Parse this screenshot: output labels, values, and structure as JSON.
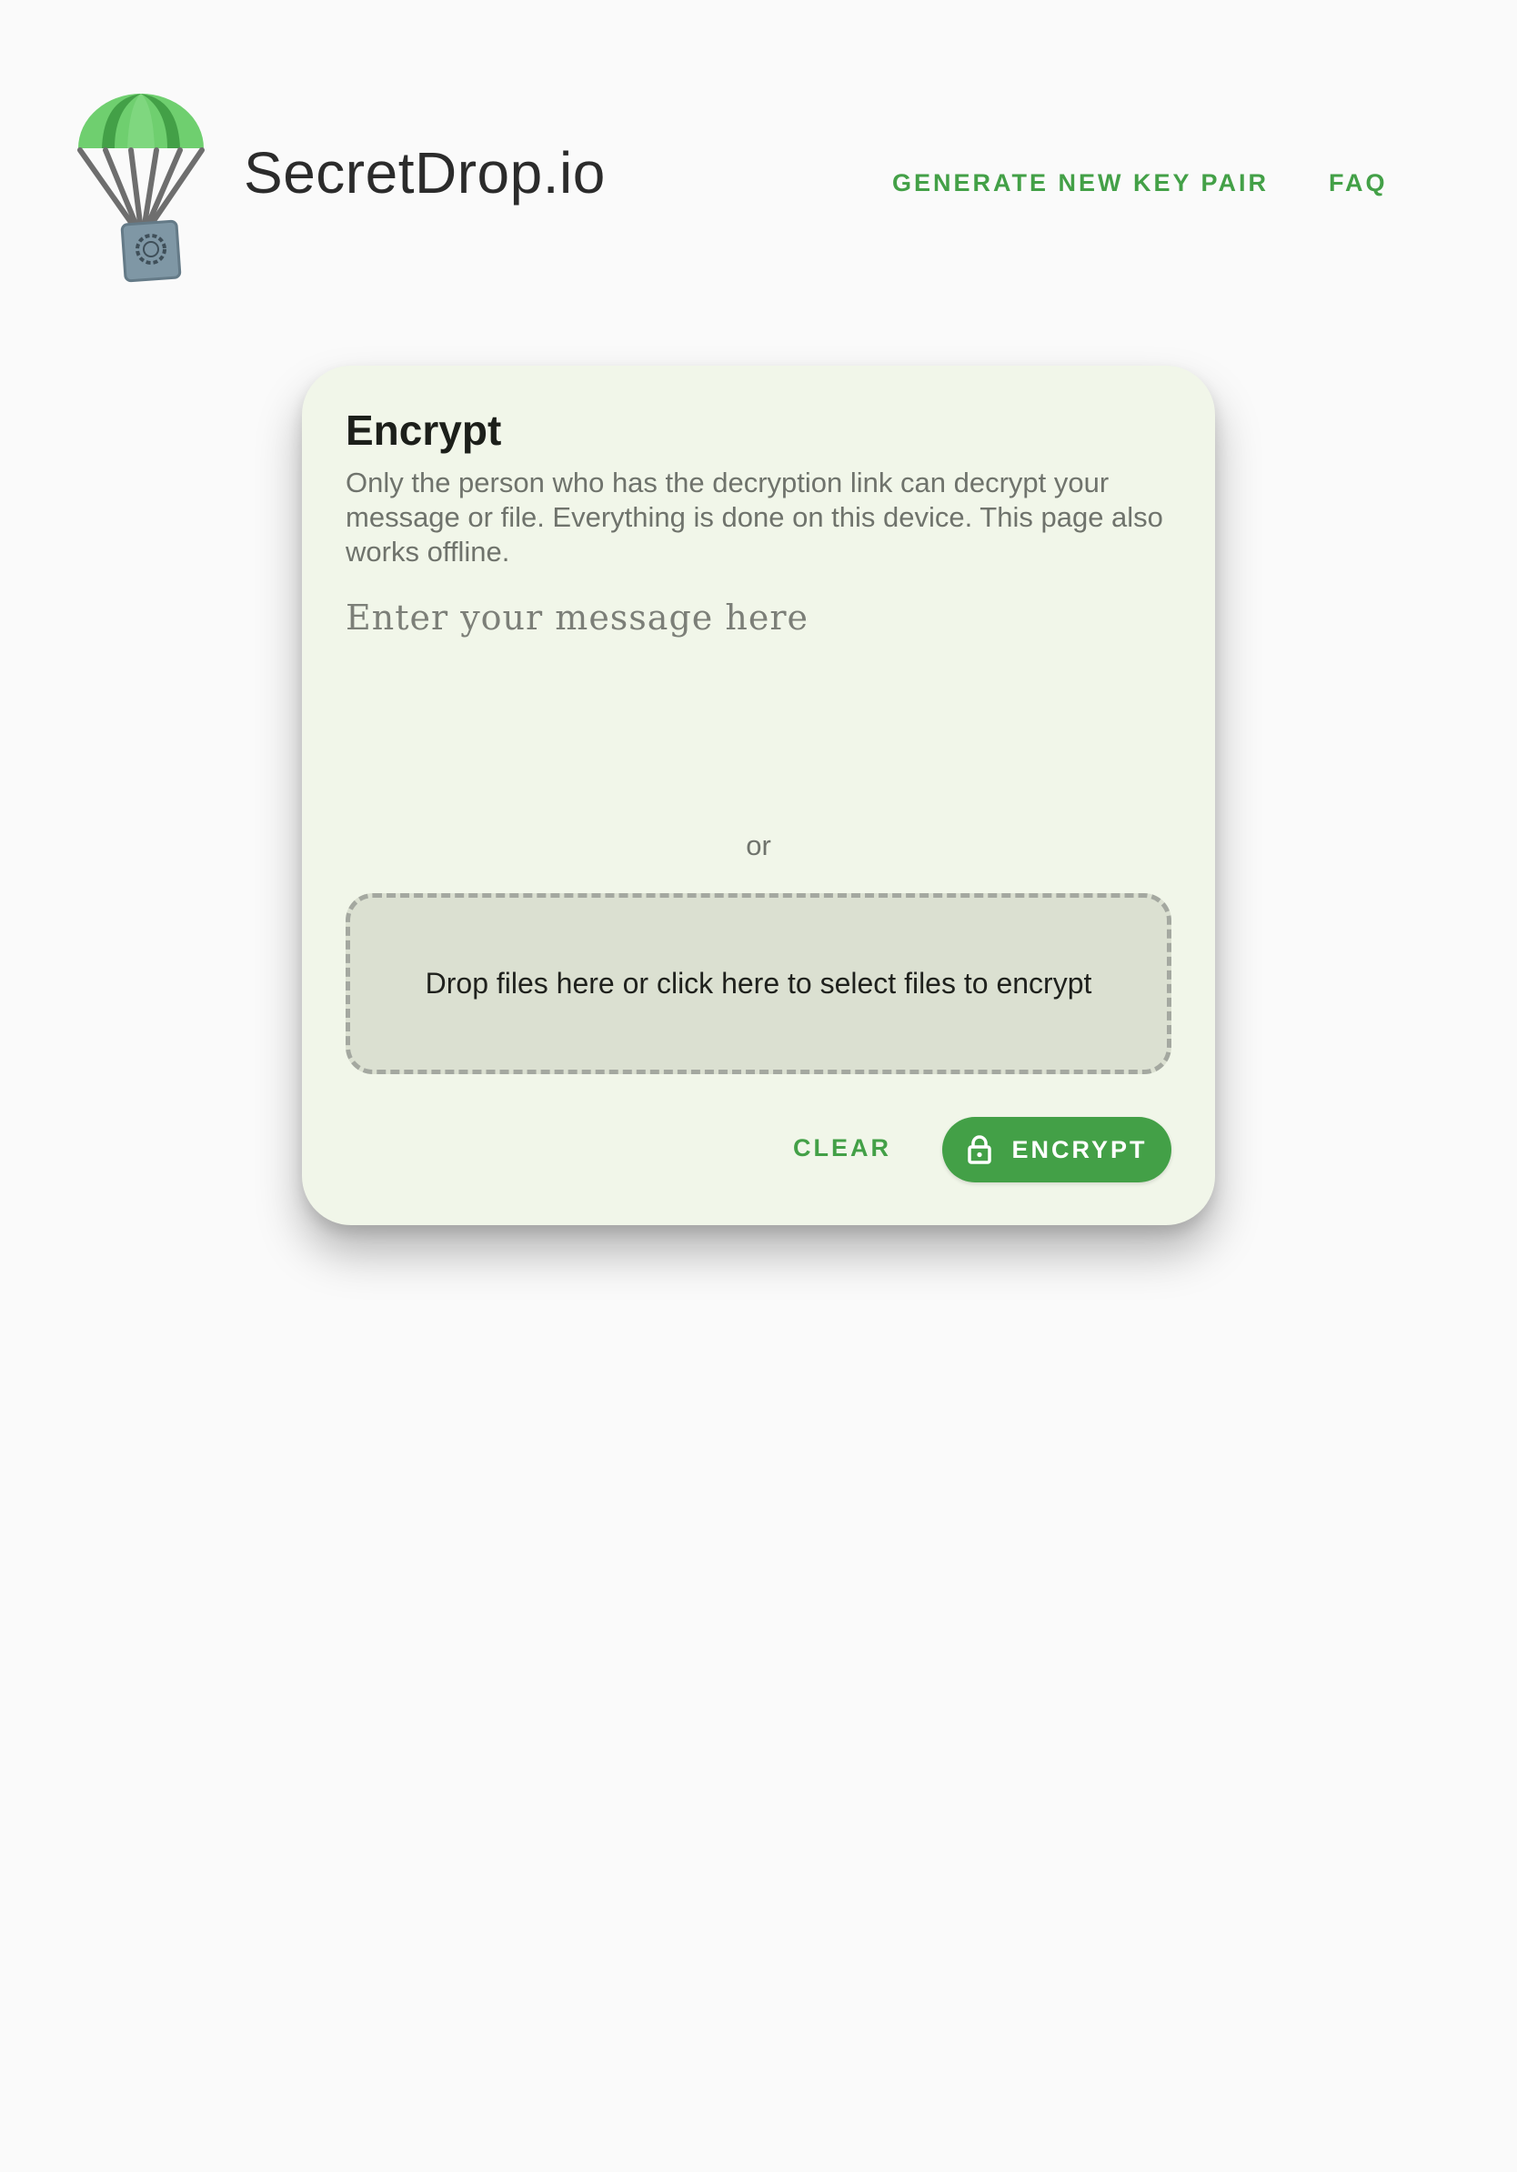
{
  "header": {
    "app_title": "SecretDrop.io",
    "nav": {
      "generate_label": "GENERATE NEW KEY PAIR",
      "faq_label": "FAQ"
    },
    "logo_icon": "parachute-safe-icon"
  },
  "card": {
    "title": "Encrypt",
    "description": "Only the person who has the decryption link can decrypt your message or file. Everything is done on this device. This page also works offline.",
    "message_placeholder": "Enter your message here",
    "message_value": "",
    "or_label": "or",
    "dropzone_label": "Drop files here or click here to select files to encrypt",
    "clear_label": "CLEAR",
    "encrypt_label": "ENCRYPT",
    "encrypt_icon": "lock-icon"
  },
  "colors": {
    "accent": "#43a047",
    "page_background": "#fafafa",
    "card_background": "#f1f6e9",
    "dropzone_background": "#dbe0d1"
  }
}
